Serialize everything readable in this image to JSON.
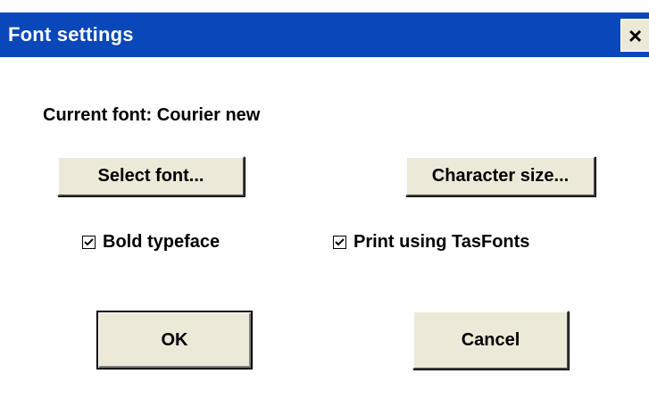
{
  "window": {
    "title": "Font settings",
    "close_glyph": "×"
  },
  "current_font": {
    "label": "Current font:",
    "value": "Courier new"
  },
  "buttons": {
    "select_font": "Select font...",
    "character_size": "Character size...",
    "ok": "OK",
    "cancel": "Cancel"
  },
  "checkboxes": {
    "bold_typeface": {
      "label": "Bold typeface",
      "checked": true
    },
    "print_tasfonts": {
      "label": "Print using TasFonts",
      "checked": true
    }
  },
  "icons": {
    "close": "close-icon",
    "checkmark": "checkmark-icon"
  },
  "colors": {
    "title_bar": "#0a47b8",
    "button_face": "#ece9d8"
  }
}
